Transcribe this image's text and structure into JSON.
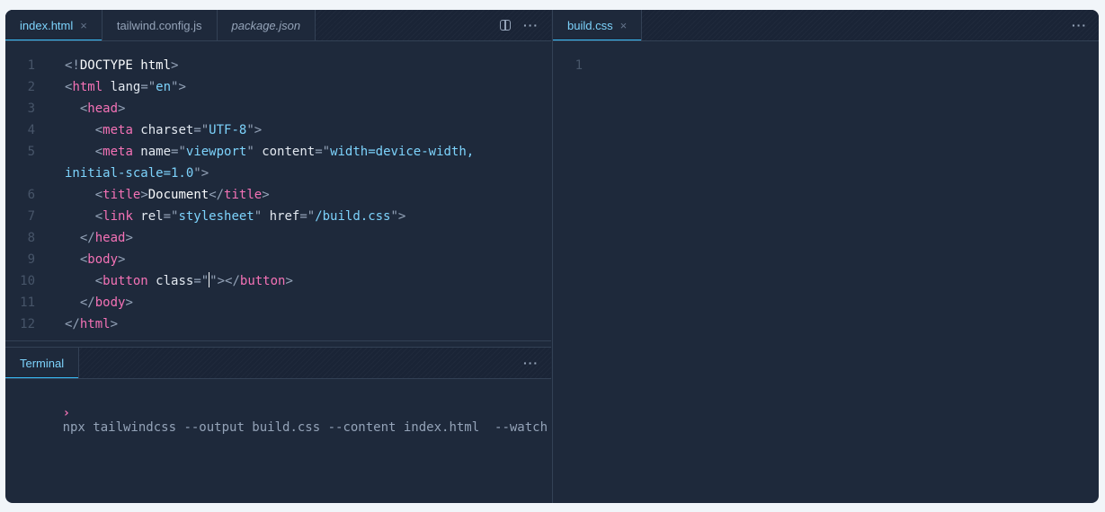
{
  "left_pane": {
    "tabs": [
      {
        "label": "index.html",
        "close": "×",
        "active": true,
        "italic": false
      },
      {
        "label": "tailwind.config.js",
        "active": false,
        "italic": false
      },
      {
        "label": "package.json",
        "active": false,
        "italic": true
      }
    ],
    "actions": {
      "split_icon": "split-editor-icon",
      "more": "···"
    },
    "lines": [
      {
        "n": "1",
        "tokens": [
          [
            "p",
            "<!"
          ],
          [
            "x",
            "DOCTYPE html"
          ],
          [
            "p",
            ">"
          ]
        ]
      },
      {
        "n": "2",
        "tokens": [
          [
            "p",
            "<"
          ],
          [
            "t",
            "html"
          ],
          [
            "a",
            " lang"
          ],
          [
            "p",
            "=\""
          ],
          [
            "s",
            "en"
          ],
          [
            "p",
            "\">"
          ]
        ]
      },
      {
        "n": "3",
        "tokens": [
          [
            "a",
            "  "
          ],
          [
            "p",
            "<"
          ],
          [
            "t",
            "head"
          ],
          [
            "p",
            ">"
          ]
        ]
      },
      {
        "n": "4",
        "tokens": [
          [
            "a",
            "    "
          ],
          [
            "p",
            "<"
          ],
          [
            "t",
            "meta"
          ],
          [
            "a",
            " charset"
          ],
          [
            "p",
            "=\""
          ],
          [
            "s",
            "UTF-8"
          ],
          [
            "p",
            "\">"
          ]
        ]
      },
      {
        "n": "5",
        "tokens": [
          [
            "a",
            "    "
          ],
          [
            "p",
            "<"
          ],
          [
            "t",
            "meta"
          ],
          [
            "a",
            " name"
          ],
          [
            "p",
            "=\""
          ],
          [
            "s",
            "viewport"
          ],
          [
            "p",
            "\""
          ],
          [
            "a",
            " content"
          ],
          [
            "p",
            "=\""
          ],
          [
            "s",
            "width=device-width,"
          ]
        ]
      },
      {
        "n": "",
        "tokens": [
          [
            "s",
            "initial-scale=1.0"
          ],
          [
            "p",
            "\">"
          ]
        ]
      },
      {
        "n": "6",
        "tokens": [
          [
            "a",
            "    "
          ],
          [
            "p",
            "<"
          ],
          [
            "t",
            "title"
          ],
          [
            "p",
            ">"
          ],
          [
            "x",
            "Document"
          ],
          [
            "p",
            "</"
          ],
          [
            "t",
            "title"
          ],
          [
            "p",
            ">"
          ]
        ]
      },
      {
        "n": "7",
        "tokens": [
          [
            "a",
            "    "
          ],
          [
            "p",
            "<"
          ],
          [
            "t",
            "link"
          ],
          [
            "a",
            " rel"
          ],
          [
            "p",
            "=\""
          ],
          [
            "s",
            "stylesheet"
          ],
          [
            "p",
            "\""
          ],
          [
            "a",
            " href"
          ],
          [
            "p",
            "=\""
          ],
          [
            "s",
            "/build.css"
          ],
          [
            "p",
            "\">"
          ]
        ]
      },
      {
        "n": "8",
        "tokens": [
          [
            "a",
            "  "
          ],
          [
            "p",
            "</"
          ],
          [
            "t",
            "head"
          ],
          [
            "p",
            ">"
          ]
        ]
      },
      {
        "n": "9",
        "tokens": [
          [
            "a",
            "  "
          ],
          [
            "p",
            "<"
          ],
          [
            "t",
            "body"
          ],
          [
            "p",
            ">"
          ]
        ]
      },
      {
        "n": "10",
        "tokens": [
          [
            "a",
            "    "
          ],
          [
            "p",
            "<"
          ],
          [
            "t",
            "button"
          ],
          [
            "a",
            " class"
          ],
          [
            "p",
            "=\""
          ],
          [
            "caret",
            ""
          ],
          [
            "p",
            "\"></"
          ],
          [
            "t",
            "button"
          ],
          [
            "p",
            ">"
          ]
        ]
      },
      {
        "n": "11",
        "tokens": [
          [
            "a",
            "  "
          ],
          [
            "p",
            "</"
          ],
          [
            "t",
            "body"
          ],
          [
            "p",
            ">"
          ]
        ]
      },
      {
        "n": "12",
        "tokens": [
          [
            "p",
            "</"
          ],
          [
            "t",
            "html"
          ],
          [
            "p",
            ">"
          ]
        ]
      }
    ]
  },
  "terminal": {
    "tab_label": "Terminal",
    "more": "···",
    "prompt": "›",
    "command": "npx tailwindcss --output build.css --content index.html  --watch"
  },
  "right_pane": {
    "tab_label": "build.css",
    "close": "×",
    "more": "···",
    "lines": [
      {
        "n": "1"
      }
    ]
  },
  "colors": {
    "background": "#1e293b",
    "tag": "#f472b6",
    "string": "#7dd3fc",
    "punctuation": "#94a3b8",
    "accent": "#38bdf8"
  }
}
